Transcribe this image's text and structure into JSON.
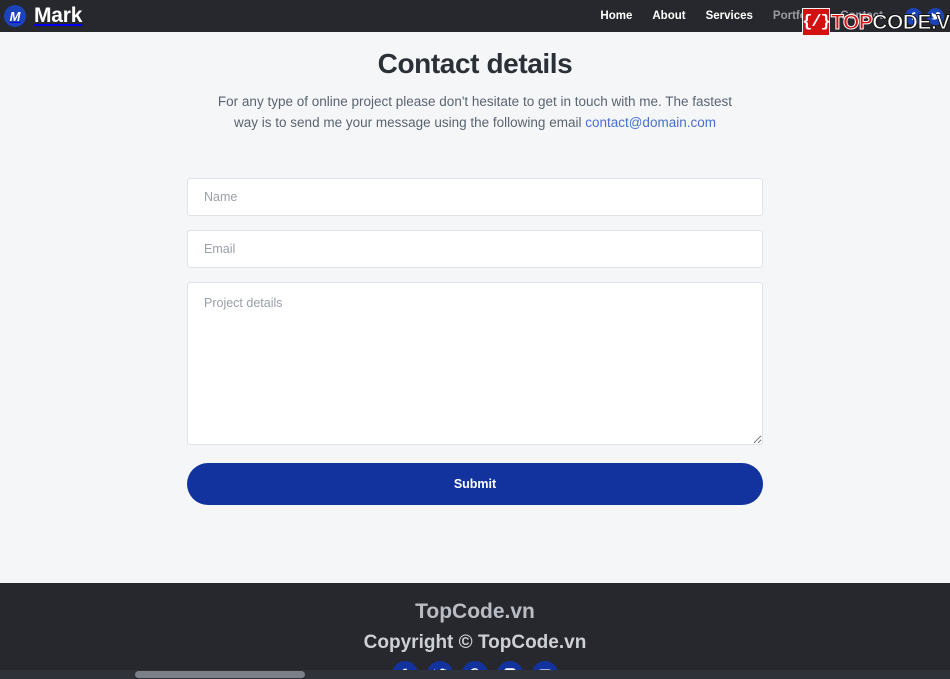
{
  "navbar": {
    "brand": {
      "badge_letter": "M",
      "name": "Mark",
      "badge_color": "#1b44ba"
    },
    "links": [
      {
        "label": "Home",
        "state": "active"
      },
      {
        "label": "About",
        "state": "active"
      },
      {
        "label": "Services",
        "state": "active"
      },
      {
        "label": "Portfolio",
        "state": "obscured"
      },
      {
        "label": "Contact",
        "state": "dim"
      }
    ],
    "social": [
      {
        "name": "facebook-icon",
        "glyph": "f"
      },
      {
        "name": "twitter-icon",
        "glyph": "t"
      }
    ]
  },
  "watermark": {
    "logo_glyph": "{/}",
    "text_primary": "TOP",
    "text_secondary": "CODE.VN",
    "primary_color": "#d21111",
    "secondary_color": "#ffffff"
  },
  "main": {
    "title": "Contact details",
    "description_before": "For any type of online project please don't hesitate to get in touch with me. The fastest way is to send me your message using the following email ",
    "email": "contact@domain.com",
    "email_color": "#4a6ed0"
  },
  "form": {
    "name_field": {
      "value": "",
      "placeholder": "Name"
    },
    "email_field": {
      "value": "",
      "placeholder": "Email"
    },
    "details_field": {
      "value": "",
      "placeholder": "Project details"
    },
    "submit_label": "Submit",
    "submit_color": "#12339e"
  },
  "footer": {
    "brand": "TopCode.vn",
    "copyright": "Copyright © TopCode.vn",
    "background": "#26282e",
    "social": [
      {
        "name": "facebook-icon"
      },
      {
        "name": "twitter-icon"
      },
      {
        "name": "pinterest-icon"
      },
      {
        "name": "instagram-icon"
      },
      {
        "name": "youtube-icon"
      }
    ]
  }
}
